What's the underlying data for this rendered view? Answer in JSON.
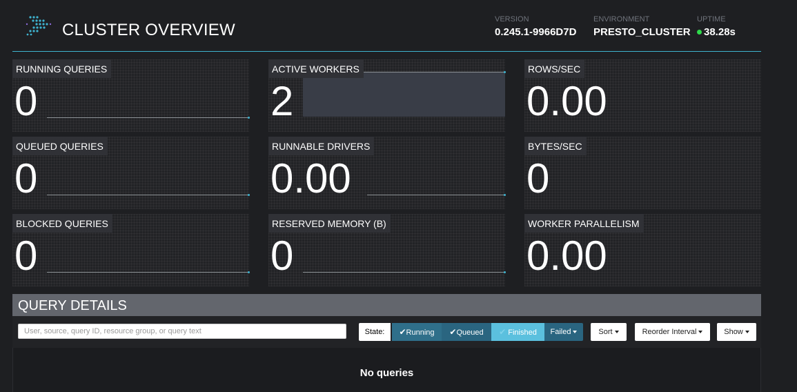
{
  "header": {
    "title": "CLUSTER OVERVIEW",
    "version_label": "VERSION",
    "version": "0.245.1-9966D7D",
    "environment_label": "ENVIRONMENT",
    "environment": "PRESTO_CLUSTER",
    "uptime_label": "UPTIME",
    "uptime": "38.28s",
    "uptime_status_color": "#2ed94a"
  },
  "stats": [
    {
      "label": "RUNNING QUERIES",
      "value": "0"
    },
    {
      "label": "ACTIVE WORKERS",
      "value": "2"
    },
    {
      "label": "ROWS/SEC",
      "value": "0.00"
    },
    {
      "label": "QUEUED QUERIES",
      "value": "0"
    },
    {
      "label": "RUNNABLE DRIVERS",
      "value": "0.00"
    },
    {
      "label": "BYTES/SEC",
      "value": "0"
    },
    {
      "label": "BLOCKED QUERIES",
      "value": "0"
    },
    {
      "label": "RESERVED MEMORY (B)",
      "value": "0"
    },
    {
      "label": "WORKER PARALLELISM",
      "value": "0.00"
    }
  ],
  "query_details": {
    "title": "QUERY DETAILS",
    "search_placeholder": "User, source, query ID, resource group, or query text",
    "state_label": "State:",
    "filters": {
      "running": "Running",
      "queued": "Queued",
      "finished": "Finished",
      "failed": "Failed"
    },
    "sort_label": "Sort",
    "reorder_label": "Reorder Interval",
    "show_label": "Show",
    "empty_message": "No queries"
  },
  "colors": {
    "accent": "#3fb4d0",
    "background": "#1e1f22",
    "panel_header": "#63666d",
    "filter_active": "#2a6580",
    "filter_light": "#5bc0de"
  }
}
